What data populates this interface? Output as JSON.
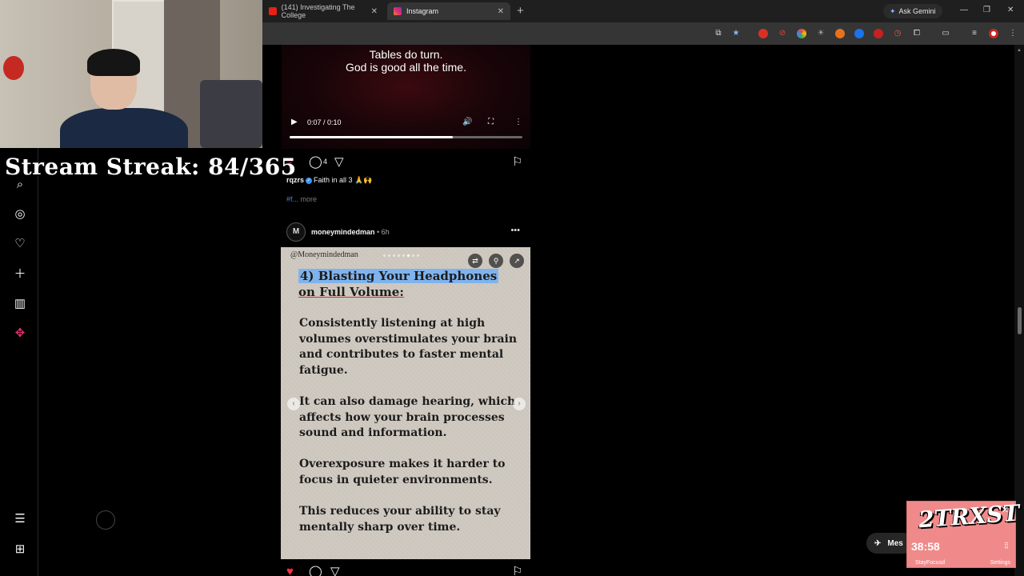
{
  "browser": {
    "tabs": [
      {
        "title": "(141) Investigating The College",
        "active": false
      },
      {
        "title": "Instagram",
        "active": true
      }
    ],
    "ask_gemini": "Ask Gemini"
  },
  "video": {
    "caption_line1": "Tables do turn.",
    "caption_line2": "God is good all the time.",
    "time": "0:07 / 0:10",
    "progress": 0.7
  },
  "post1": {
    "likes": "4",
    "username": "rqzrs",
    "caption": "Faith in all 3 🙏🙌",
    "hashtag": "#f...",
    "more": "more"
  },
  "post2": {
    "avatar_text": "M",
    "username": "moneymindedman",
    "age": "• 6h",
    "slide": {
      "handle": "@Moneymindedman",
      "title_line1": "4) Blasting Your Headphones",
      "title_line2": "on Full Volume:",
      "p1": "Consistently listening at high volumes overstimulates your brain and contributes to faster mental fatigue.",
      "p2": "It can also damage hearing, which affects how your brain processes sound and information.",
      "p3": "Overexposure makes it harder to focus in quieter environments.",
      "p4": "This reduces your ability to stay mentally sharp over time."
    }
  },
  "overlay": {
    "streak": "Stream Streak: 84/365",
    "messages_label": "Mes",
    "timer_brand": "2TRXST",
    "timer_time": "38:58",
    "timer_footer": "StayFocusd",
    "timer_settings": "Settings"
  }
}
